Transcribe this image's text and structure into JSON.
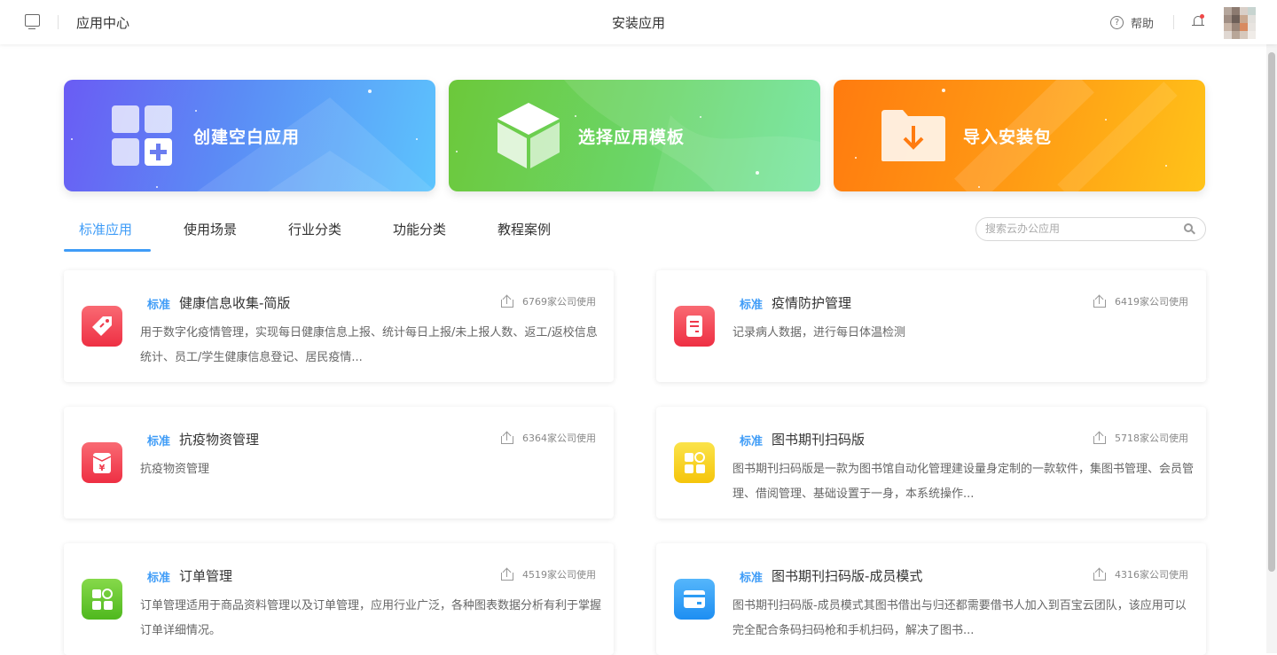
{
  "header": {
    "app_center": "应用中心",
    "title": "安装应用",
    "help": "帮助",
    "help_icon": "?"
  },
  "banners": [
    {
      "label": "创建空白应用",
      "icon": "grid-plus-icon",
      "color": "#6a8cf6"
    },
    {
      "label": "选择应用模板",
      "icon": "cube-icon",
      "color": "#6cd06a"
    },
    {
      "label": "导入安装包",
      "icon": "folder-download-icon",
      "color": "#ff9a14"
    }
  ],
  "tabs": [
    "标准应用",
    "使用场景",
    "行业分类",
    "功能分类",
    "教程案例"
  ],
  "search": {
    "placeholder": "搜索云办公应用"
  },
  "apps": [
    {
      "tag": "标准",
      "name": "健康信息收集-简版",
      "usage": "6769家公司使用",
      "desc": "用于数字化疫情管理，实现每日健康信息上报、统计每日上报/未上报人数、返工/返校信息统计、员工/学生健康信息登记、居民疫情...",
      "icon": "tag-icon",
      "color": "#f5424f"
    },
    {
      "tag": "标准",
      "name": "疫情防护管理",
      "usage": "6419家公司使用",
      "desc": "记录病人数据，进行每日体温检测",
      "icon": "document-icon",
      "color": "#f5424f"
    },
    {
      "tag": "标准",
      "name": "抗疫物资管理",
      "usage": "6364家公司使用",
      "desc": "抗疫物资管理",
      "icon": "yen-bag-icon",
      "color": "#f5424f"
    },
    {
      "tag": "标准",
      "name": "图书期刊扫码版",
      "usage": "5718家公司使用",
      "desc": "图书期刊扫码版是一款为图书馆自动化管理建设量身定制的一款软件，集图书管理、会员管理、借阅管理、基础设置于一身，本系统操作...",
      "icon": "apps-icon",
      "color": "#f7cf12"
    },
    {
      "tag": "标准",
      "name": "订单管理",
      "usage": "4519家公司使用",
      "desc": "订单管理适用于商品资料管理以及订单管理，应用行业广泛，各种图表数据分析有利于掌握订单详细情况。",
      "icon": "apps-icon",
      "color": "#5ec42a"
    },
    {
      "tag": "标准",
      "name": "图书期刊扫码版-成员模式",
      "usage": "4316家公司使用",
      "desc": "图书期刊扫码版-成员模式其图书借出与归还都需要借书人加入到百宝云团队，该应用可以完全配合条码扫码枪和手机扫码，解决了图书...",
      "icon": "card-icon",
      "color": "#2c9cf4"
    }
  ]
}
